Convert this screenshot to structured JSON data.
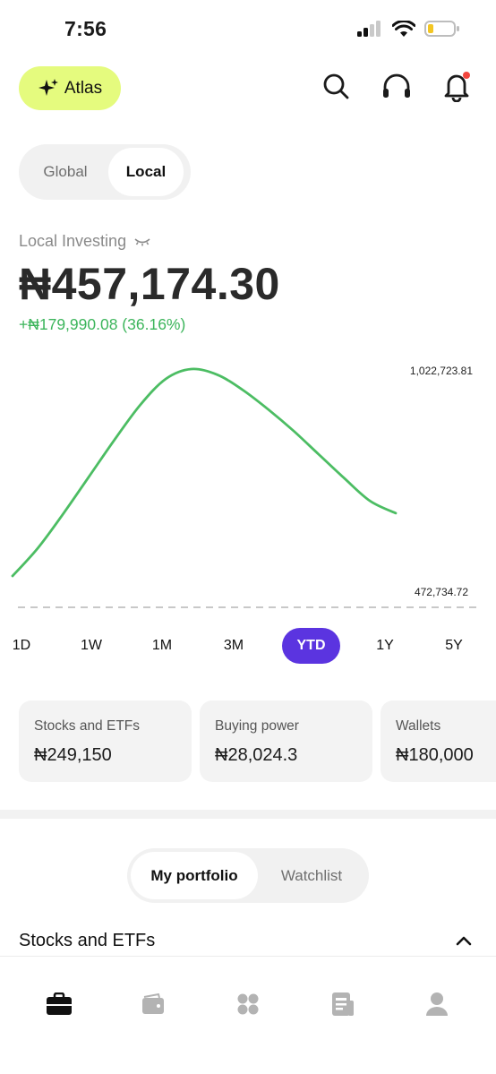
{
  "status_bar": {
    "time": "7:56"
  },
  "header": {
    "atlas_label": "Atlas",
    "accent_color": "#e5fb7e",
    "icons": [
      "search-icon",
      "headset-icon",
      "bell-icon"
    ]
  },
  "market_toggle": {
    "options": [
      "Global",
      "Local"
    ],
    "selected": "Local"
  },
  "balance": {
    "label": "Local Investing",
    "value": "₦457,174.30",
    "change": "+₦179,990.08 (36.16%)",
    "change_color": "#3cb55b"
  },
  "chart": {
    "max_label": "1,022,723.81",
    "min_label": "472,734.72",
    "line_color": "#4cbd63"
  },
  "chart_data": {
    "type": "line",
    "title": "",
    "xlabel": "",
    "ylabel": "",
    "ylim": [
      472734.72,
      1022723.81
    ],
    "series": [
      {
        "values": [
          545000,
          610000,
          690000,
          775000,
          860000,
          940000,
          1000000,
          1022723.81,
          1010000,
          975000,
          930000,
          880000,
          825000,
          770000,
          718000,
          690000
        ]
      }
    ],
    "grid": false,
    "legend": "none"
  },
  "ranges": {
    "items": [
      "1D",
      "1W",
      "1M",
      "3M",
      "YTD",
      "1Y",
      "5Y"
    ],
    "selected": "YTD",
    "accent_color": "#5b34e0"
  },
  "summary_cards": [
    {
      "label": "Stocks and ETFs",
      "value": "₦249,150"
    },
    {
      "label": "Buying power",
      "value": "₦28,024.3"
    },
    {
      "label": "Wallets",
      "value": "₦180,000"
    }
  ],
  "portfolio_toggle": {
    "options": [
      "My portfolio",
      "Watchlist"
    ],
    "selected": "My portfolio"
  },
  "section": {
    "title": "Stocks and ETFs"
  },
  "tab_bar": {
    "items": [
      "briefcase-icon",
      "wallet-icon",
      "apps-icon",
      "news-icon",
      "profile-icon"
    ],
    "selected": "briefcase-icon"
  }
}
